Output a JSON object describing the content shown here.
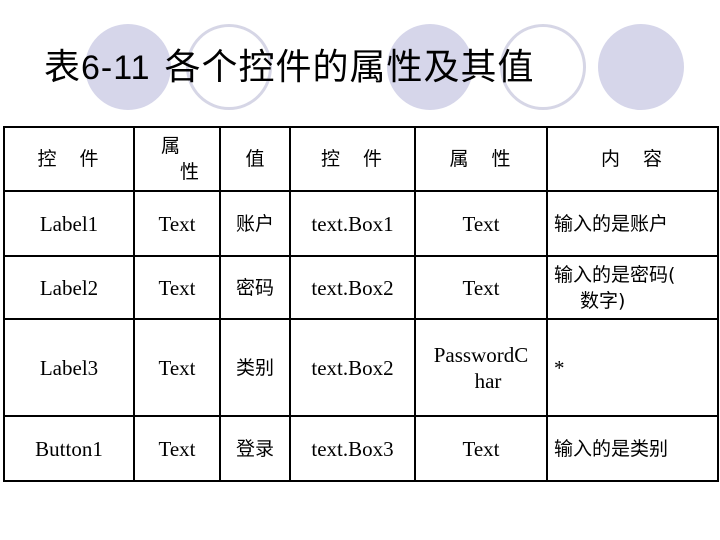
{
  "title": {
    "prefix": "表",
    "number": "6-11",
    "text": "各个控件的属性及其值"
  },
  "decor": {
    "circle_color": "#d6d6ea",
    "circles": [
      "filled",
      "outline",
      "filled",
      "outline",
      "filled"
    ]
  },
  "table": {
    "headers": [
      "控　件",
      "属\n性",
      "值",
      "控　件",
      "属　性",
      "内　容"
    ],
    "header_lines": {
      "col2_line1": "属",
      "col2_line2": "性"
    },
    "rows": [
      [
        "Label1",
        "Text",
        "账户",
        "text.Box1",
        "Text",
        "输入的是账户"
      ],
      [
        "Label2",
        "Text",
        "密码",
        "text.Box2",
        "Text",
        "输入的是密码(数字)"
      ],
      [
        "Label3",
        "Text",
        "类别",
        "text.Box2",
        "PasswordChar",
        "*"
      ],
      [
        "Button1",
        "Text",
        "登录",
        "text.Box3",
        "Text",
        "输入的是类别"
      ]
    ],
    "wrapped": {
      "row2_col6_line1": "输入的是密码(",
      "row2_col6_line2": "数字)",
      "row3_col5_line1": "PasswordC",
      "row3_col5_line2": "har"
    }
  }
}
